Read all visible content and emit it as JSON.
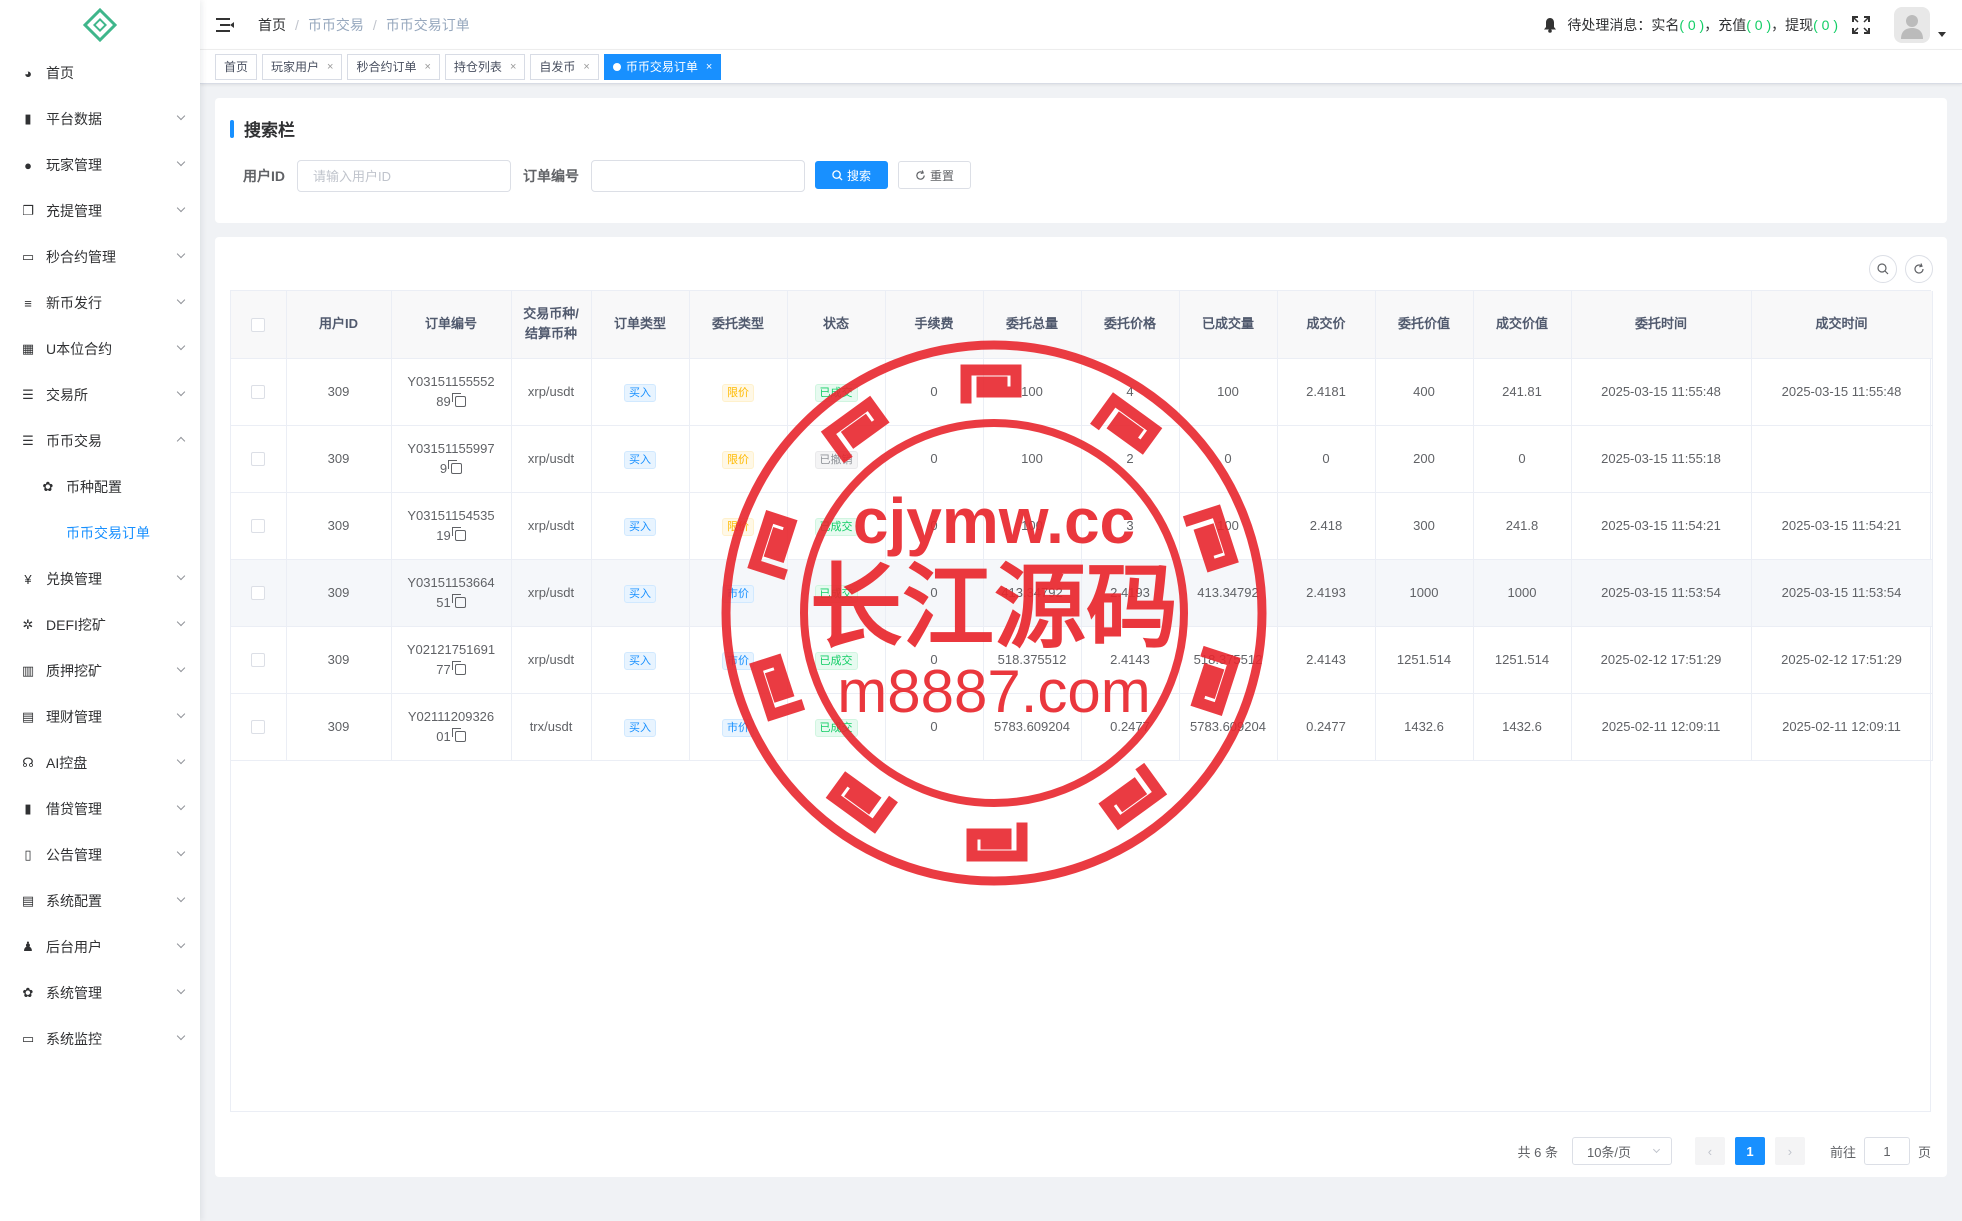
{
  "sidebar": {
    "items": [
      {
        "label": "首页",
        "icon": "dashboard-icon"
      },
      {
        "label": "平台数据",
        "icon": "book-icon"
      },
      {
        "label": "玩家管理",
        "icon": "user-icon"
      },
      {
        "label": "充提管理",
        "icon": "copy-icon"
      },
      {
        "label": "秒合约管理",
        "icon": "monitor-icon"
      },
      {
        "label": "新币发行",
        "icon": "message-icon"
      },
      {
        "label": "U本位合约",
        "icon": "grid-icon"
      },
      {
        "label": "交易所",
        "icon": "list-icon"
      },
      {
        "label": "币币交易",
        "icon": "list-icon"
      }
    ],
    "sub_items": [
      {
        "label": "币种配置",
        "icon": "gear-icon"
      },
      {
        "label": "币币交易订单"
      }
    ],
    "items_after": [
      {
        "label": "兑换管理",
        "icon": "yen-icon"
      },
      {
        "label": "DEFI挖矿",
        "icon": "bug-icon"
      },
      {
        "label": "质押挖矿",
        "icon": "chart-icon"
      },
      {
        "label": "理财管理",
        "icon": "document-icon"
      },
      {
        "label": "AI控盘",
        "icon": "robot-icon"
      },
      {
        "label": "借贷管理",
        "icon": "book-icon"
      },
      {
        "label": "公告管理",
        "icon": "open-book-icon"
      },
      {
        "label": "系统配置",
        "icon": "document-icon"
      },
      {
        "label": "后台用户",
        "icon": "peoples-icon"
      },
      {
        "label": "系统管理",
        "icon": "gear-icon"
      },
      {
        "label": "系统监控",
        "icon": "monitor-icon"
      }
    ]
  },
  "header": {
    "breadcrumb": [
      "首页",
      "币币交易",
      "币币交易订单"
    ],
    "notice_prefix": "待处理消息：",
    "notice_items": [
      {
        "label": "实名",
        "count": "( 0 )"
      },
      {
        "label": "充值",
        "count": "( 0 )"
      },
      {
        "label": "提现",
        "count": "( 0 )"
      }
    ],
    "comma": "，"
  },
  "tags": [
    {
      "label": "首页",
      "closable": false
    },
    {
      "label": "玩家用户",
      "closable": true
    },
    {
      "label": "秒合约订单",
      "closable": true
    },
    {
      "label": "持仓列表",
      "closable": true
    },
    {
      "label": "自发币",
      "closable": true
    },
    {
      "label": "币币交易订单",
      "closable": true,
      "active": true
    }
  ],
  "search": {
    "title": "搜索栏",
    "user_id_label": "用户ID",
    "user_id_placeholder": "请输入用户ID",
    "order_label": "订单编号",
    "order_placeholder": "",
    "search_btn": "搜索",
    "reset_btn": "重置"
  },
  "table": {
    "columns": [
      "",
      "用户ID",
      "订单编号",
      "交易币种/\n结算币种",
      "订单类型",
      "委托类型",
      "状态",
      "手续费",
      "委托总量",
      "委托价格",
      "已成交量",
      "成交价",
      "委托价值",
      "成交价值",
      "委托时间",
      "成交时间"
    ],
    "rows": [
      {
        "user_id": "309",
        "order_no_1": "Y03151155552",
        "order_no_2": "89",
        "pair": "xrp/usdt",
        "order_type": "买入",
        "entrust_type": "限价",
        "status": "已成交",
        "fee": "0",
        "total": "100",
        "price": "4",
        "filled": "100",
        "deal_price": "2.4181",
        "entrust_value": "400",
        "deal_value": "241.81",
        "entrust_time": "2025-03-15 11:55:48",
        "deal_time": "2025-03-15 11:55:48"
      },
      {
        "user_id": "309",
        "order_no_1": "Y03151155997",
        "order_no_2": "9",
        "pair": "xrp/usdt",
        "order_type": "买入",
        "entrust_type": "限价",
        "status": "已撤销",
        "fee": "0",
        "total": "100",
        "price": "2",
        "filled": "0",
        "deal_price": "0",
        "entrust_value": "200",
        "deal_value": "0",
        "entrust_time": "2025-03-15 11:55:18",
        "deal_time": ""
      },
      {
        "user_id": "309",
        "order_no_1": "Y03151154535",
        "order_no_2": "19",
        "pair": "xrp/usdt",
        "order_type": "买入",
        "entrust_type": "限价",
        "status": "已成交",
        "fee": "0",
        "total": "100",
        "price": "3",
        "filled": "100",
        "deal_price": "2.418",
        "entrust_value": "300",
        "deal_value": "241.8",
        "entrust_time": "2025-03-15 11:54:21",
        "deal_time": "2025-03-15 11:54:21"
      },
      {
        "user_id": "309",
        "order_no_1": "Y03151153664",
        "order_no_2": "51",
        "pair": "xrp/usdt",
        "order_type": "买入",
        "entrust_type": "市价",
        "status": "已成交",
        "fee": "0",
        "total": "413.34792",
        "price": "2.4193",
        "filled": "413.34792",
        "deal_price": "2.4193",
        "entrust_value": "1000",
        "deal_value": "1000",
        "entrust_time": "2025-03-15 11:53:54",
        "deal_time": "2025-03-15 11:53:54"
      },
      {
        "user_id": "309",
        "order_no_1": "Y02121751691",
        "order_no_2": "77",
        "pair": "xrp/usdt",
        "order_type": "买入",
        "entrust_type": "市价",
        "status": "已成交",
        "fee": "0",
        "total": "518.375512",
        "price": "2.4143",
        "filled": "518.375512",
        "deal_price": "2.4143",
        "entrust_value": "1251.514",
        "deal_value": "1251.514",
        "entrust_time": "2025-02-12 17:51:29",
        "deal_time": "2025-02-12 17:51:29"
      },
      {
        "user_id": "309",
        "order_no_1": "Y02111209326",
        "order_no_2": "01",
        "pair": "trx/usdt",
        "order_type": "买入",
        "entrust_type": "市价",
        "status": "已成交",
        "fee": "0",
        "total": "5783.609204",
        "price": "0.2477",
        "filled": "5783.609204",
        "deal_price": "0.2477",
        "entrust_value": "1432.6",
        "deal_value": "1432.6",
        "entrust_time": "2025-02-11 12:09:11",
        "deal_time": "2025-02-11 12:09:11"
      }
    ]
  },
  "pagination": {
    "total": "共 6 条",
    "page_size": "10条/页",
    "current": "1",
    "goto_label": "前往",
    "goto_value": "1",
    "page_unit": "页"
  },
  "watermark": {
    "line1": "cjymw.cc",
    "line2": "长江源码",
    "line3": "m8887.com",
    "color": "#e8262d"
  }
}
